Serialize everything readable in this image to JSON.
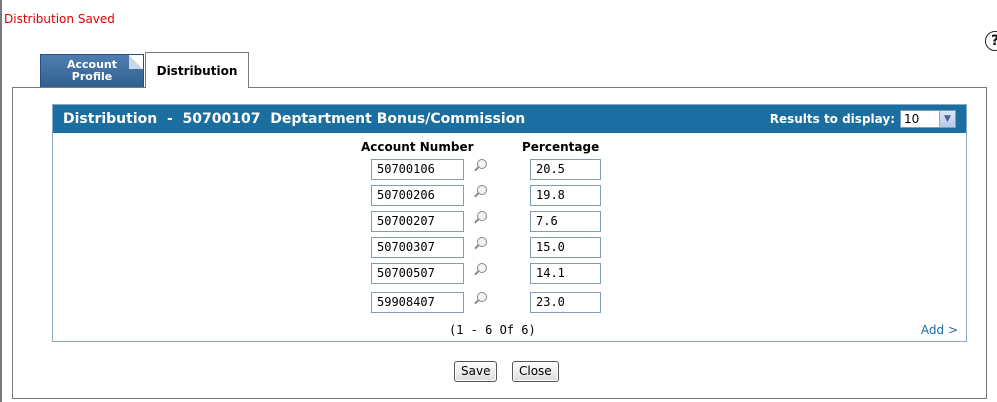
{
  "status_message": "Distribution Saved",
  "tabs": [
    {
      "label": "Account Profile",
      "active": false
    },
    {
      "label": "Distribution",
      "active": true
    }
  ],
  "panel": {
    "title": "Distribution  -  50700107  Deptartment Bonus/Commission",
    "results_label": "Results to display:",
    "results_value": "10",
    "col_account": "Account Number",
    "col_percentage": "Percentage",
    "rows": [
      {
        "account": "50700106",
        "percentage": "20.5"
      },
      {
        "account": "50700206",
        "percentage": "19.8"
      },
      {
        "account": "50700207",
        "percentage": "7.6"
      },
      {
        "account": "50700307",
        "percentage": "15.0"
      },
      {
        "account": "50700507",
        "percentage": "14.1"
      },
      {
        "account": "59908407",
        "percentage": "23.0"
      }
    ],
    "pager": "(1 - 6 Of 6)",
    "add_label": "Add >"
  },
  "buttons": {
    "save": "Save",
    "close": "Close"
  },
  "colors": {
    "header": "#1a6ea0",
    "status": "#e00000",
    "tab_inactive": "#3a6a9c"
  },
  "icons": {
    "help": "help-icon",
    "lookup": "magnifier-icon",
    "dropdown": "chevron-down-icon"
  }
}
